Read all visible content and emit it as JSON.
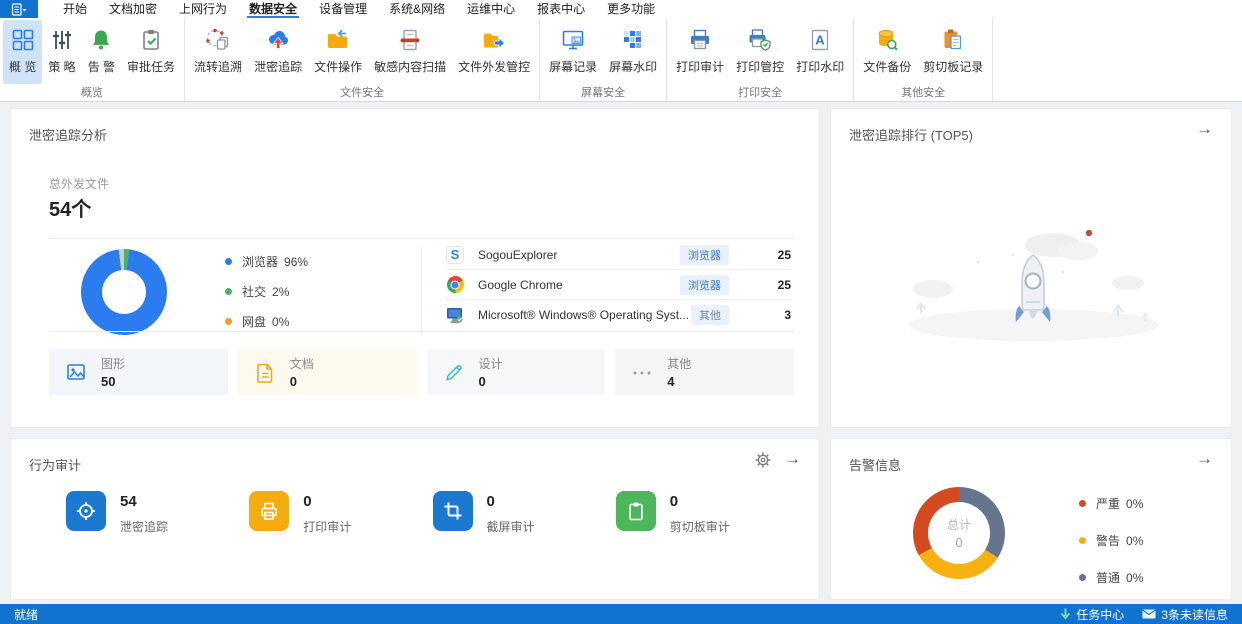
{
  "colors": {
    "accent": "#2b7cee",
    "statusbar": "#1173d0",
    "ribbon_selected": "#cfe4f7",
    "donut_blue": "#2b7cee",
    "donut_green": "#4cb06d",
    "donut_gray": "#c9ced6",
    "alert_red": "#d5491f",
    "alert_amber": "#f7b212",
    "alert_slate": "#64758d"
  },
  "menubar": {
    "items": [
      {
        "label": "开始"
      },
      {
        "label": "文档加密"
      },
      {
        "label": "上网行为"
      },
      {
        "label": "数据安全"
      },
      {
        "label": "设备管理"
      },
      {
        "label": "系统&网络"
      },
      {
        "label": "运维中心"
      },
      {
        "label": "报表中心"
      },
      {
        "label": "更多功能"
      }
    ]
  },
  "ribbon": {
    "groups": [
      {
        "label": "概览",
        "buttons": [
          {
            "label": "概 览",
            "icon": "overview-grid"
          },
          {
            "label": "策 略",
            "icon": "policy-sliders"
          },
          {
            "label": "告 警",
            "icon": "alert-bell"
          },
          {
            "label": "审批任务",
            "icon": "approval-clipboard"
          }
        ]
      },
      {
        "label": "文件安全",
        "buttons": [
          {
            "label": "流转追溯",
            "icon": "flow-trace"
          },
          {
            "label": "泄密追踪",
            "icon": "leak-cloud"
          },
          {
            "label": "文件操作",
            "icon": "folder-return"
          },
          {
            "label": "敏感内容扫描",
            "icon": "scan-doc"
          },
          {
            "label": "文件外发管控",
            "icon": "folder-out"
          }
        ]
      },
      {
        "label": "屏幕安全",
        "buttons": [
          {
            "label": "屏幕记录",
            "icon": "screen-record"
          },
          {
            "label": "屏幕水印",
            "icon": "pixel-watermark"
          }
        ]
      },
      {
        "label": "打印安全",
        "buttons": [
          {
            "label": "打印审计",
            "icon": "printer"
          },
          {
            "label": "打印管控",
            "icon": "printer-shield"
          },
          {
            "label": "打印水印",
            "icon": "watermark-a"
          }
        ]
      },
      {
        "label": "其他安全",
        "buttons": [
          {
            "label": "文件备份",
            "icon": "db-search"
          },
          {
            "label": "剪切板记录",
            "icon": "clipboard-doc"
          }
        ]
      }
    ]
  },
  "trace_panel": {
    "title": "泄密追踪分析",
    "total_label": "总外发文件",
    "total_value": "54个",
    "legend": [
      {
        "label": "浏览器",
        "pct": "96%"
      },
      {
        "label": "社交",
        "pct": "2%"
      },
      {
        "label": "网盘",
        "pct": "0%"
      }
    ],
    "apps": [
      {
        "name": "SogouExplorer",
        "badge": "浏览器",
        "value": "25"
      },
      {
        "name": "Google Chrome",
        "badge": "浏览器",
        "value": "25"
      },
      {
        "name": "Microsoft® Windows® Operating Syst...",
        "badge": "其他",
        "value": "3"
      }
    ],
    "tiles": [
      {
        "label": "图形",
        "value": "50"
      },
      {
        "label": "文档",
        "value": "0"
      },
      {
        "label": "设计",
        "value": "0"
      },
      {
        "label": "其他",
        "value": "4"
      }
    ]
  },
  "rank_panel": {
    "title": "泄密追踪排行 (TOP5)",
    "arrow": "→"
  },
  "audit_panel": {
    "title": "行为审计",
    "arrow": "→",
    "stats": [
      {
        "value": "54",
        "label": "泄密追踪"
      },
      {
        "value": "0",
        "label": "打印审计"
      },
      {
        "value": "0",
        "label": "截屏审计"
      },
      {
        "value": "0",
        "label": "剪切板审计"
      }
    ]
  },
  "alerts_panel": {
    "title": "告警信息",
    "arrow": "→",
    "center_label": "总计",
    "center_value": "0",
    "legend": [
      {
        "label": "严重",
        "pct": "0%"
      },
      {
        "label": "警告",
        "pct": "0%"
      },
      {
        "label": "普通",
        "pct": "0%"
      }
    ]
  },
  "statusbar": {
    "left": "就绪",
    "task_center": "任务中心",
    "unread": "3条未读信息"
  },
  "donuts": {
    "trace": [
      {
        "color": "#4cb06d",
        "value": 2
      },
      {
        "color": "#2b7cee",
        "value": 96
      },
      {
        "color": "#c9ced6",
        "value": 2
      }
    ],
    "alerts": [
      {
        "color": "#64758d",
        "value": 34
      },
      {
        "color": "#f7b212",
        "value": 33
      },
      {
        "color": "#d5491f",
        "value": 33
      }
    ]
  },
  "chart_data": [
    {
      "type": "pie",
      "title": "泄密追踪分析 外发渠道占比",
      "labels": [
        "浏览器",
        "社交",
        "网盘"
      ],
      "values": [
        96,
        2,
        0
      ],
      "unit": "%",
      "annotations": [
        "总外发文件 54个"
      ],
      "legend_position": "right"
    },
    {
      "type": "pie",
      "title": "告警信息",
      "labels": [
        "严重",
        "警告",
        "普通"
      ],
      "values": [
        0,
        0,
        0
      ],
      "unit": "%",
      "annotations": [
        "总计 0"
      ],
      "legend_position": "right"
    }
  ]
}
